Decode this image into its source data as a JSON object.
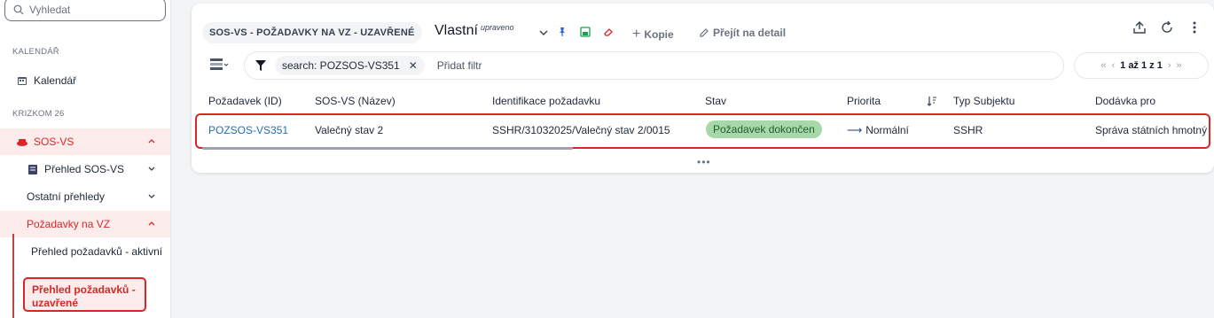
{
  "sidebar": {
    "search_placeholder": "Vyhledat",
    "section_calendar": "KALENDÁŘ",
    "calendar_item": "Kalendář",
    "section_krizkom": "KRIZKOM 26",
    "sos_vs": "SOS-VS",
    "prehled_sos_vs": "Přehled SOS-VS",
    "ostatni_prehledy": "Ostatní přehledy",
    "pozadavky_na_vz": "Požadavky na VZ",
    "prehled_aktivni": "Přehled požadavků - aktivní",
    "prehled_uzavrene": "Přehled požadavků - uzavřené"
  },
  "card": {
    "title": "SOS-VS - POŽADAVKY NA VZ - UZAVŘENÉ",
    "view_name": "Vlastní",
    "view_modified": "upraveno",
    "copy_label": "Kopie",
    "detail_label": "Přejít na detail"
  },
  "filter": {
    "chip_label": "search: POZSOS-VS351",
    "add_filter": "Přidat filtr"
  },
  "pager": {
    "text": "1 až 1 z 1"
  },
  "table": {
    "columns": {
      "id": "Požadavek (ID)",
      "name": "SOS-VS (Název)",
      "ident": "Identifikace požadavku",
      "status": "Stav",
      "priority": "Priorita",
      "subject": "Typ Subjektu",
      "supplier": "Dodávka pro"
    },
    "rows": [
      {
        "id": "POZSOS-VS351",
        "name": "Valečný stav 2",
        "ident": "SSHR/31032025/Valečný stav 2/0015",
        "status": "Požadavek dokončen",
        "priority": "Normální",
        "subject": "SSHR",
        "supplier": "Správa státních hmotný"
      }
    ]
  },
  "colors": {
    "accent_red": "#dc2626",
    "link_blue": "#1f6fb5",
    "status_green": "#a7d8a9"
  }
}
